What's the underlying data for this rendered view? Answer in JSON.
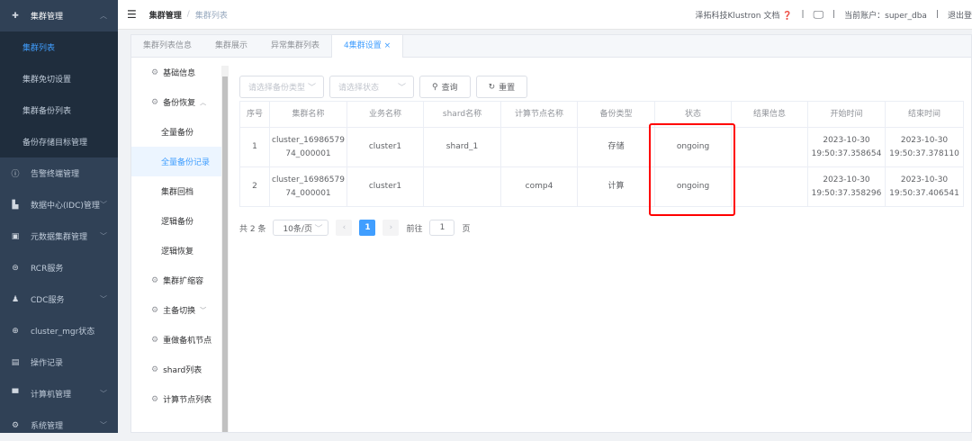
{
  "sidebar": {
    "top": {
      "label": "集群管理"
    },
    "sub": [
      "集群列表",
      "集群免切设置",
      "集群备份列表",
      "备份存储目标管理"
    ],
    "items": [
      {
        "label": "告警终端管理",
        "icon": "alert-icon"
      },
      {
        "label": "数据中心(IDC)管理",
        "icon": "datacenter-icon"
      },
      {
        "label": "元数据集群管理",
        "icon": "metadata-icon"
      },
      {
        "label": "RCR服务",
        "icon": "rcr-icon"
      },
      {
        "label": "CDC服务",
        "icon": "cdc-icon"
      },
      {
        "label": "cluster_mgr状态",
        "icon": "status-icon"
      },
      {
        "label": "操作记录",
        "icon": "log-icon"
      },
      {
        "label": "计算机管理",
        "icon": "computer-icon"
      },
      {
        "label": "系统管理",
        "icon": "settings-icon"
      }
    ]
  },
  "header": {
    "breadcrumb": [
      "集群管理",
      "集群列表"
    ],
    "docs": "泽拓科技Klustron 文档",
    "account": "当前账户：super_dba",
    "logout": "退出登"
  },
  "tabs": [
    "集群列表信息",
    "集群展示",
    "异常集群列表",
    "4集群设置"
  ],
  "subnav": [
    "基础信息",
    "备份恢复",
    "全量备份",
    "全量备份记录",
    "集群回档",
    "逻辑备份",
    "逻辑恢复",
    "集群扩缩容",
    "主备切换",
    "重做备机节点",
    "shard列表",
    "计算节点列表"
  ],
  "filters": {
    "type_placeholder": "请选择备份类型",
    "status_placeholder": "请选择状态",
    "query": "查询",
    "reset": "重置"
  },
  "table": {
    "columns": [
      "序号",
      "集群名称",
      "业务名称",
      "shard名称",
      "计算节点名称",
      "备份类型",
      "状态",
      "结果信息",
      "开始时间",
      "结束时间"
    ],
    "rows": [
      [
        "1",
        "cluster_1698657974_000001",
        "cluster1",
        "shard_1",
        "",
        "存储",
        "ongoing",
        "",
        "2023-10-30 19:50:37.358654",
        "2023-10-30 19:50:37.378110"
      ],
      [
        "2",
        "cluster_1698657974_000001",
        "cluster1",
        "",
        "comp4",
        "计算",
        "ongoing",
        "",
        "2023-10-30 19:50:37.358296",
        "2023-10-30 19:50:37.406541"
      ]
    ]
  },
  "pager": {
    "total": "共 2 条",
    "size": "10条/页",
    "prev": "‹",
    "page": "1",
    "next": "›",
    "goto": "前往",
    "goto_value": "1",
    "unit": "页"
  }
}
